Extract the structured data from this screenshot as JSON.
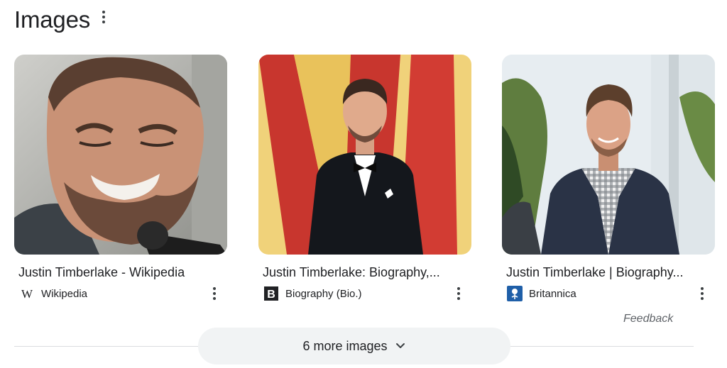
{
  "header": {
    "title": "Images",
    "menu_icon": "more-vert-icon"
  },
  "cards": [
    {
      "title": "Justin Timberlake - Wikipedia",
      "source": "Wikipedia",
      "source_icon": "wikipedia-w-icon",
      "image_subject": "Smiling bearded man speaking into a microphone"
    },
    {
      "title": "Justin Timberlake: Biography,...",
      "source": "Biography (Bio.)",
      "source_icon": "biography-b-icon",
      "image_subject": "Man in black tuxedo on red and yellow backdrop"
    },
    {
      "title": "Justin Timberlake | Biography...",
      "source": "Britannica",
      "source_icon": "britannica-thistle-icon",
      "image_subject": "Man in dark cardigan and gingham shirt outdoors"
    }
  ],
  "feedback": "Feedback",
  "more_button": {
    "label": "6 more images",
    "icon": "chevron-down-icon"
  },
  "colors": {
    "text": "#202124",
    "muted": "#5f6368",
    "button_bg": "#f1f3f4",
    "divider": "#dadce0"
  }
}
